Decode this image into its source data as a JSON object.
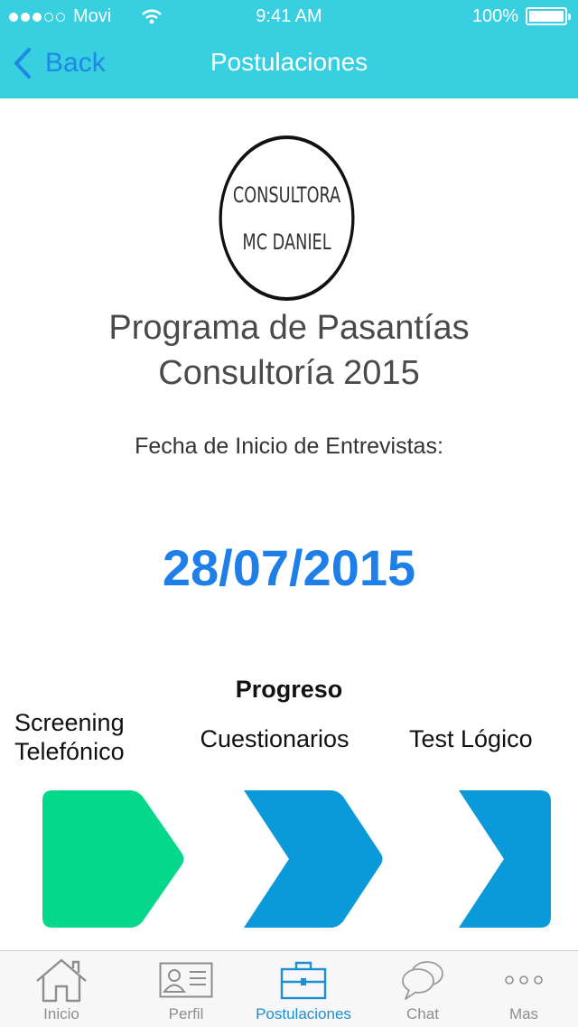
{
  "status_bar": {
    "carrier": "Movi",
    "time": "9:41 AM",
    "battery": "100%"
  },
  "nav": {
    "back_label": "Back",
    "title": "Postulaciones"
  },
  "company_logo": {
    "line1": "CONSULTORA",
    "line2": "MC DANIEL"
  },
  "program": {
    "title_line1": "Programa de Pasantías",
    "title_line2": "Consultoría 2015"
  },
  "interview": {
    "label": "Fecha de Inicio de Entrevistas:",
    "date": "28/07/2015"
  },
  "progress": {
    "heading": "Progreso",
    "steps": [
      {
        "line1": "Screening",
        "line2": "Telefónico",
        "color": "#05d88b"
      },
      {
        "line1": "Cuestionarios",
        "line2": "",
        "color": "#0a99d9"
      },
      {
        "line1": "Test Lógico",
        "line2": "",
        "color": "#0a99d9"
      }
    ]
  },
  "tabbar": {
    "active_color": "#1a8fd6",
    "items": [
      {
        "label": "Inicio",
        "icon": "home-icon"
      },
      {
        "label": "Perfil",
        "icon": "profile-card-icon"
      },
      {
        "label": "Postulaciones",
        "icon": "briefcase-icon",
        "active": true
      },
      {
        "label": "Chat",
        "icon": "chat-bubbles-icon"
      },
      {
        "label": "Mas",
        "icon": "more-dots-icon"
      }
    ]
  },
  "colors": {
    "header": "#38cfe0",
    "accent_blue": "#1e7fe8"
  }
}
